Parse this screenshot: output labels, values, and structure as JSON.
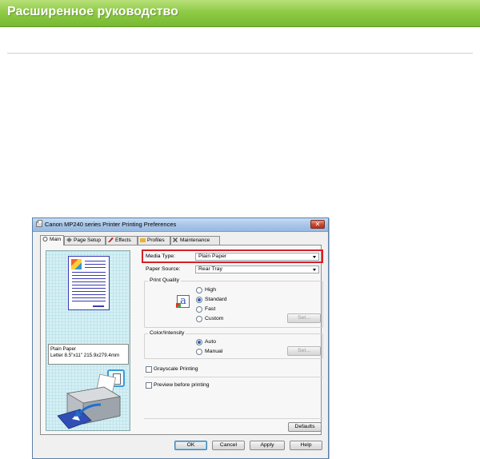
{
  "doc": {
    "header_title": "Расширенное руководство",
    "header_color": "#8fcb45"
  },
  "dialog": {
    "title": "Canon MP240 series Printer Printing Preferences",
    "close_label": "✕",
    "tabs": [
      {
        "label": "Main"
      },
      {
        "label": "Page Setup"
      },
      {
        "label": "Effects"
      },
      {
        "label": "Profiles"
      },
      {
        "label": "Maintenance"
      }
    ],
    "preview": {
      "paper_name": "Plain Paper",
      "paper_size": "Letter 8.5\"x11\" 215.9x279.4mm"
    },
    "media_type": {
      "label": "Media Type:",
      "value": "Plain Paper"
    },
    "paper_source": {
      "label": "Paper Source:",
      "value": "Rear Tray"
    },
    "print_quality": {
      "group_title": "Print Quality",
      "options": [
        "High",
        "Standard",
        "Fast",
        "Custom"
      ],
      "selected": "Standard",
      "set_label": "Set..."
    },
    "color_intensity": {
      "group_title": "Color/Intensity",
      "options": [
        "Auto",
        "Manual"
      ],
      "selected": "Auto",
      "set_label": "Set..."
    },
    "grayscale_label": "Grayscale Printing",
    "preview_before_label": "Preview before printing",
    "defaults_label": "Defaults",
    "buttons": {
      "ok": "OK",
      "cancel": "Cancel",
      "apply": "Apply",
      "help": "Help"
    },
    "highlight_color": "#d81f26"
  }
}
